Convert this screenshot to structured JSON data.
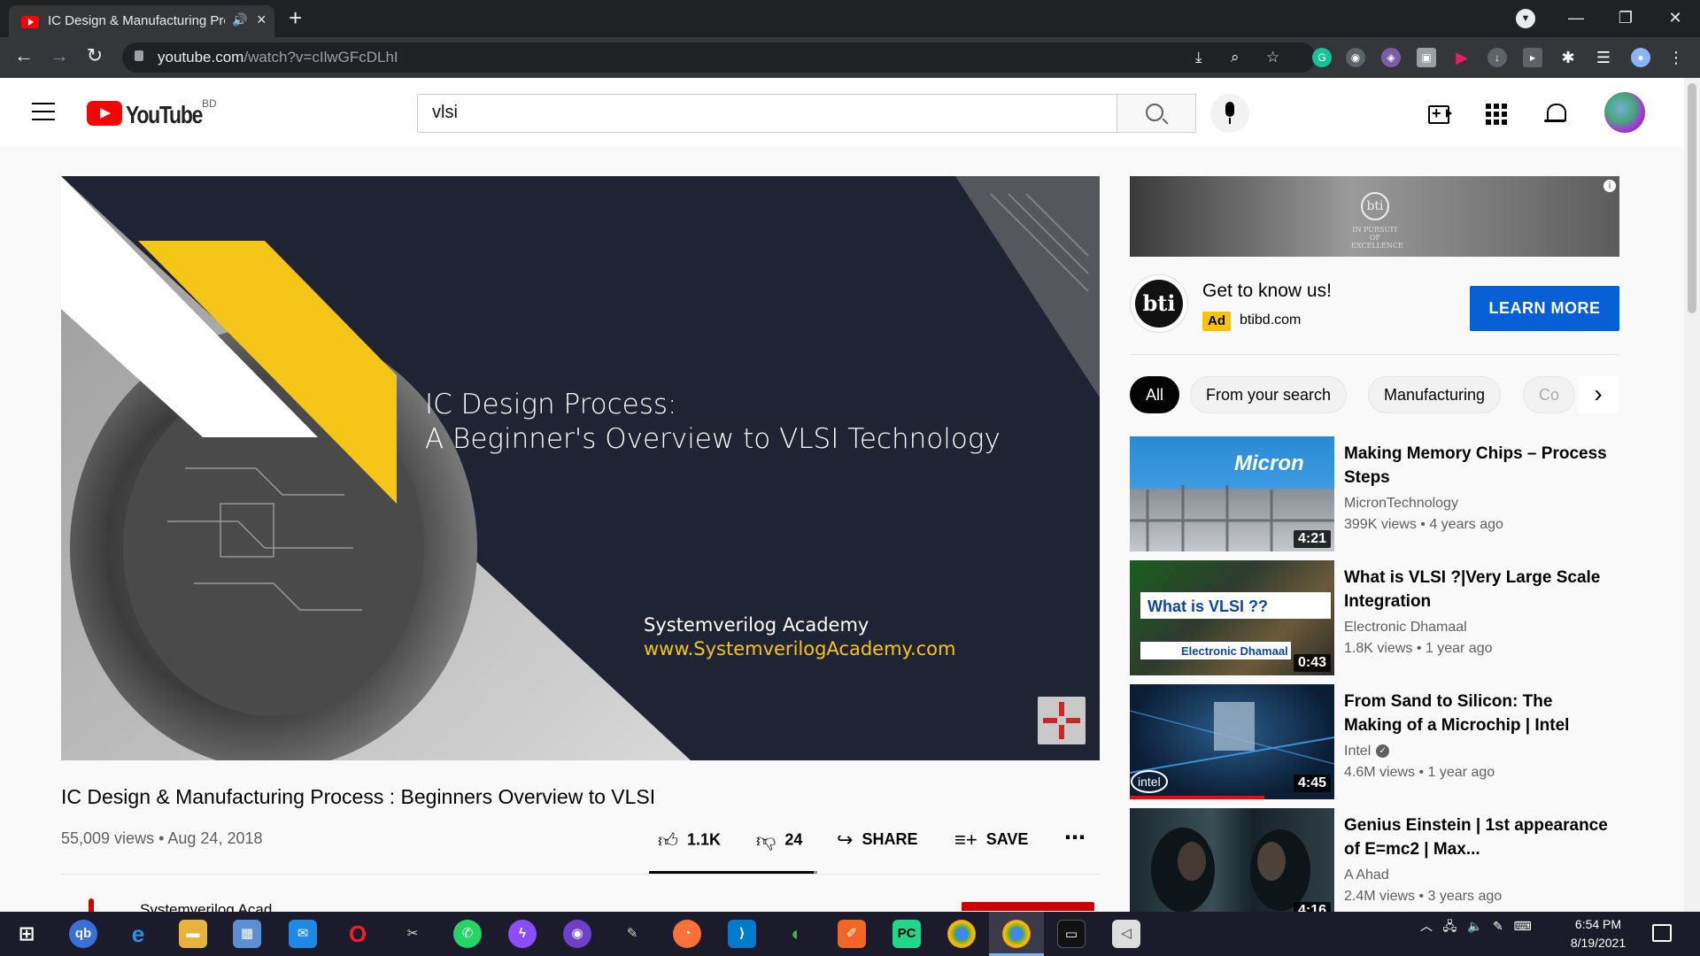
{
  "browser": {
    "tab_title": "IC Design & Manufacturing Process : Beginners Overview to VLSI",
    "url_domain": "youtube.com",
    "url_path": "/watch?v=cIlwGFcDLhI",
    "win_minimize": "—",
    "win_restore": "❐",
    "win_close": "✕"
  },
  "youtube": {
    "country_code": "BD",
    "logo_text": "YouTube",
    "search_value": "vlsi"
  },
  "video": {
    "slide_title_line1": "IC Design Process:",
    "slide_title_line2": "A Beginner's Overview to VLSI Technology",
    "slide_brand": "Systemverilog Academy",
    "slide_url": "www.SystemverilogAcademy.com",
    "title": "IC Design & Manufacturing Process : Beginners Overview to VLSI",
    "views": "55,009 views",
    "date": "Aug 24, 2018",
    "likes": "1.1K",
    "dislikes": "24",
    "like_ratio": 0.98,
    "share_label": "SHARE",
    "save_label": "SAVE",
    "channel_partial": "Systemverilog Acad"
  },
  "ad": {
    "title": "Get to know us!",
    "badge": "Ad",
    "domain": "btibd.com",
    "cta": "LEARN MORE",
    "banner_mark": "bti",
    "banner_tagline": "IN PURSUIT OF EXCELLENCE"
  },
  "chips": [
    "All",
    "From your search",
    "Manufacturing",
    "Co"
  ],
  "recommendations": [
    {
      "title": "Making Memory Chips – Process Steps",
      "channel": "MicronTechnology",
      "views": "399K views",
      "age": "4 years ago",
      "duration": "4:21",
      "thumb_text": "Micron",
      "verified": false
    },
    {
      "title": "What is VLSI ?|Very Large Scale Integration",
      "channel": "Electronic Dhamaal",
      "views": "1.8K views",
      "age": "1 year ago",
      "duration": "0:43",
      "thumb_text": "What is VLSI ??",
      "thumb_sub": "Electronic Dhamaal",
      "verified": false
    },
    {
      "title": "From Sand to Silicon: The Making of a Microchip | Intel",
      "channel": "Intel",
      "views": "4.6M views",
      "age": "1 year ago",
      "duration": "4:45",
      "thumb_text": "intel",
      "verified": true,
      "watched": 0.66
    },
    {
      "title": "Genius Einstein | 1st appearance of E=mc2 | Max...",
      "channel": "A Ahad",
      "views": "2.4M views",
      "age": "3 years ago",
      "duration": "4:16",
      "verified": false
    }
  ],
  "taskbar": {
    "time": "6:54 PM",
    "date": "8/19/2021"
  }
}
